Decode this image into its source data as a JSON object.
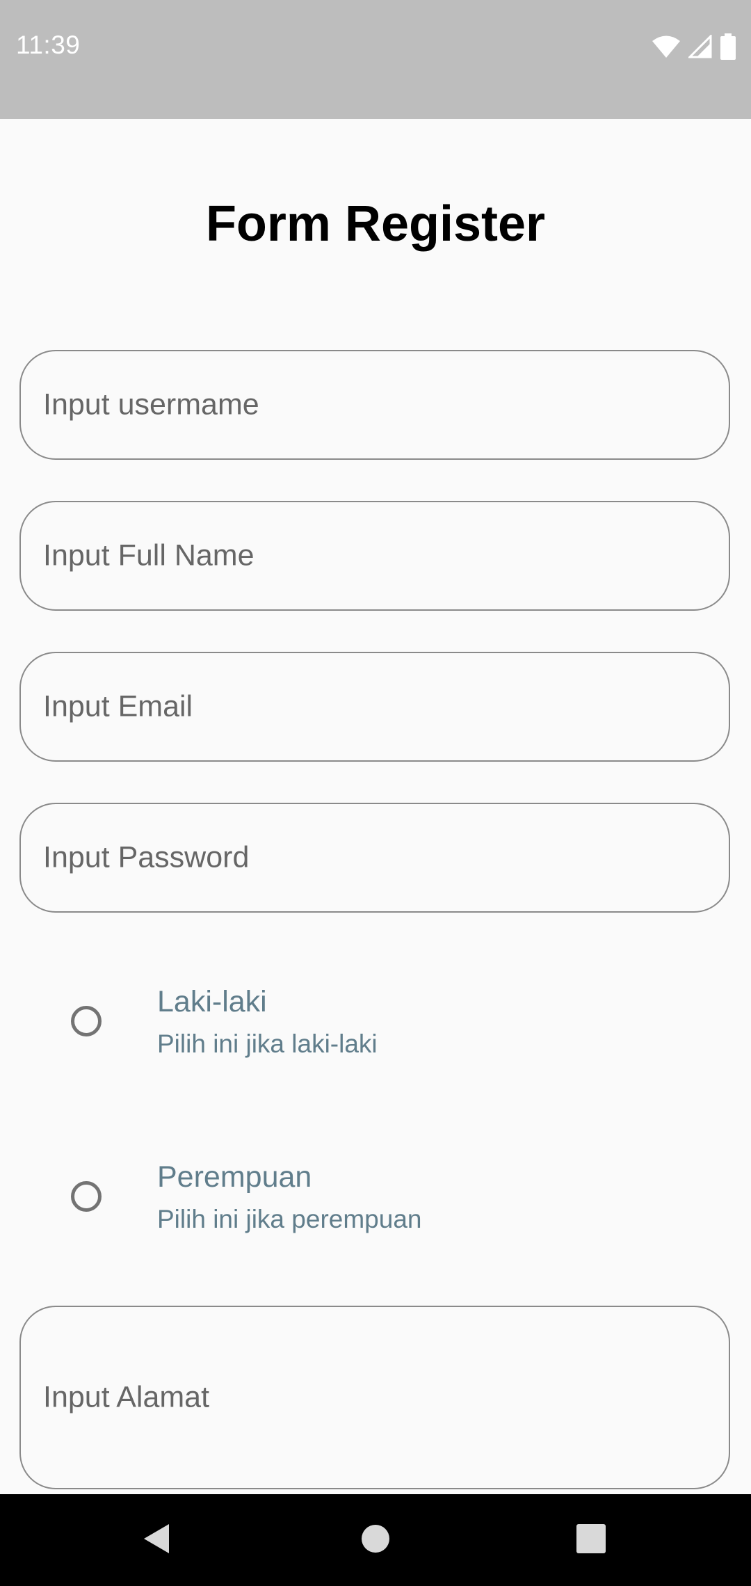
{
  "status_bar": {
    "time": "11:39",
    "icons": [
      "wifi-icon",
      "signal-icon",
      "battery-icon"
    ],
    "background": "#bdbdbd"
  },
  "form": {
    "title": "Form Register",
    "fields": {
      "username_placeholder": "Input usermame",
      "full_name_placeholder": "Input Full Name",
      "email_placeholder": "Input Email",
      "password_placeholder": "Input Password",
      "address_placeholder": "Input Alamat"
    },
    "gender_options": [
      {
        "title": "Laki-laki",
        "subtitle": "Pilih ini jika laki-laki",
        "selected": false
      },
      {
        "title": "Perempuan",
        "subtitle": "Pilih ini jika perempuan",
        "selected": false
      }
    ]
  },
  "nav_bar": {
    "buttons": [
      "back-icon",
      "home-icon",
      "recents-icon"
    ]
  },
  "colors": {
    "radio_text": "#607d8b",
    "field_border": "#8a8a8a",
    "background": "#fafafa"
  }
}
